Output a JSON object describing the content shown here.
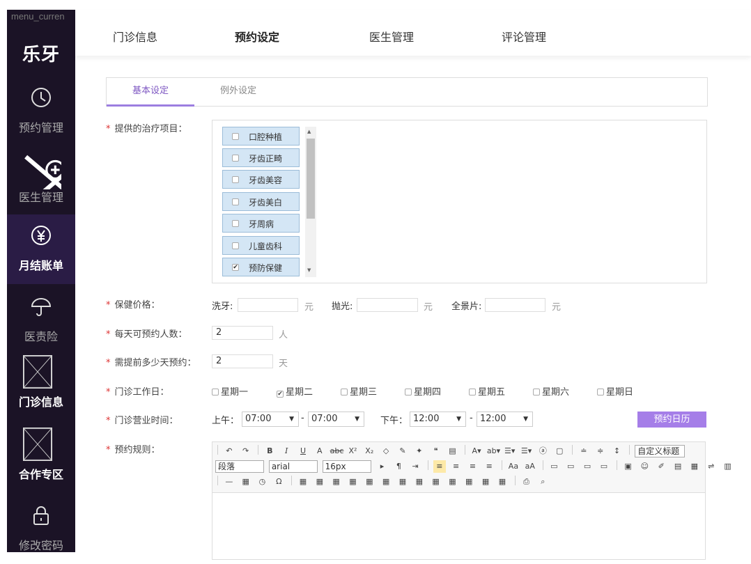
{
  "sidebar": {
    "alt_text": "menu_curren",
    "logo": "乐牙",
    "items": [
      {
        "label": "预约管理",
        "icon": "clock-icon"
      },
      {
        "label": "医生管理",
        "icon": "doctor-icon"
      },
      {
        "label": "月结账单",
        "icon": "yen-icon"
      },
      {
        "label": "医责险",
        "icon": "umbrella-icon"
      },
      {
        "label": "门诊信息",
        "icon": "image-placeholder-icon"
      },
      {
        "label": "合作专区",
        "icon": "image-placeholder-icon"
      },
      {
        "label": "修改密码",
        "icon": "lock-icon"
      }
    ]
  },
  "topnav": [
    "门诊信息",
    "预约设定",
    "医生管理",
    "评论管理"
  ],
  "tabs": [
    "基本设定",
    "例外设定"
  ],
  "form": {
    "projects_label": "提供的治疗项目：",
    "projects": [
      {
        "name": "口腔种植",
        "checked": false
      },
      {
        "name": "牙齿正畸",
        "checked": false
      },
      {
        "name": "牙齿美容",
        "checked": false
      },
      {
        "name": "牙齿美白",
        "checked": false
      },
      {
        "name": "牙周病",
        "checked": false
      },
      {
        "name": "儿童齿科",
        "checked": false
      },
      {
        "name": "预防保健",
        "checked": true
      }
    ],
    "price_label": "保健价格：",
    "price_items": [
      {
        "label": "洗牙:",
        "value": "",
        "unit": "元"
      },
      {
        "label": "抛光:",
        "value": "",
        "unit": "元"
      },
      {
        "label": "全景片:",
        "value": "",
        "unit": "元"
      }
    ],
    "daily_label": "每天可预约人数：",
    "daily_value": "2",
    "daily_unit": "人",
    "advance_label": "需提前多少天预约：",
    "advance_value": "2",
    "advance_unit": "天",
    "workday_label": "门诊工作日：",
    "weekdays": [
      {
        "name": "星期一",
        "checked": false
      },
      {
        "name": "星期二",
        "checked": true
      },
      {
        "name": "星期三",
        "checked": false
      },
      {
        "name": "星期四",
        "checked": false
      },
      {
        "name": "星期五",
        "checked": false
      },
      {
        "name": "星期六",
        "checked": false
      },
      {
        "name": "星期日",
        "checked": false
      }
    ],
    "hours_label": "门诊营业时间：",
    "am_label": "上午：",
    "am_start": "07:00",
    "am_end": "07:00",
    "pm_label": "下午：",
    "pm_start": "12:00",
    "pm_end": "12:00",
    "dash": "-",
    "calendar_button": "预约日历",
    "rules_label": "预约规则："
  },
  "editor": {
    "heading_select": "自定义标题",
    "paragraph_select": "段落",
    "font_select": "arial",
    "size_select": "16px"
  }
}
